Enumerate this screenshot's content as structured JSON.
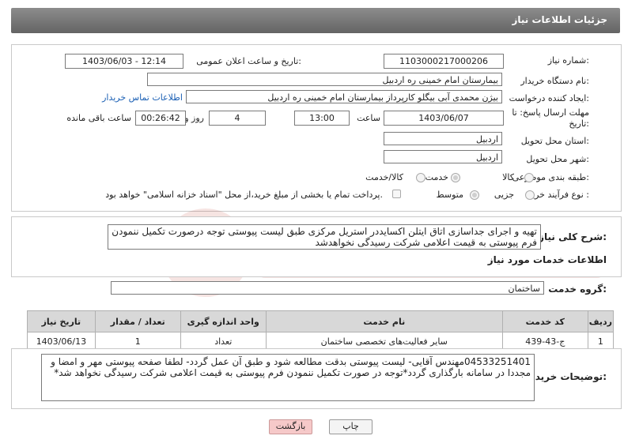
{
  "header": {
    "title": "جزئیات اطلاعات نیاز"
  },
  "form": {
    "need_number_label": "شماره نیاز:",
    "need_number": "1103000217000206",
    "announce_label": "تاریخ و ساعت اعلان عمومی:",
    "announce_value": "1403/06/03 - 12:14",
    "buyer_org_label": "نام دستگاه خریدار:",
    "buyer_org": "بیمارستان امام خمینی  ره  اردبیل",
    "creator_label": "ایجاد کننده درخواست:",
    "creator": "بیژن محمدی آبی بیگلو کارپرداز بیمارستان امام خمینی  ره  اردبیل",
    "contact_link": "اطلاعات تماس خریدار",
    "deadline_label_1": "مهلت ارسال پاسخ: تا",
    "deadline_label_2": "تاریخ:",
    "deadline_date": "1403/06/07",
    "time_label": "ساعت",
    "deadline_time": "13:00",
    "days": "4",
    "days_label": "روز و",
    "remaining_time": "00:26:42",
    "remaining_label": "ساعت باقی مانده",
    "province_label": "استان محل تحویل:",
    "province": "اردبیل",
    "city_label": "شهر محل تحویل:",
    "city": "اردبیل",
    "category_label": "طبقه بندی موضوعی:",
    "category_options": [
      "کالا",
      "خدمت",
      "کالا/خدمت"
    ],
    "category_selected": "خدمت",
    "process_label": "نوع فرآیند خرید :",
    "process_options": [
      "جزیی",
      "متوسط"
    ],
    "process_selected": "متوسط",
    "payment_note": "پرداخت تمام یا بخشی از مبلغ خرید،از محل \"اسناد خزانه اسلامی\" خواهد بود."
  },
  "summary": {
    "label": "شرح کلی نیاز:",
    "text": "تهیه و اجرای جداسازی اتاق ایتلن اکسایددر استریل مرکزی طبق لیست پیوستی توجه درصورت تکمیل ننمودن فرم پیوستی به قیمت اعلامی شرکت رسیدگی نخواهدشد"
  },
  "services": {
    "section_title": "اطلاعات خدمات مورد نیاز",
    "group_label": "گروه خدمت:",
    "group_value": "ساختمان",
    "columns": [
      "ردیف",
      "کد خدمت",
      "نام خدمت",
      "واحد اندازه گیری",
      "تعداد / مقدار",
      "تاریخ نیاز"
    ],
    "rows": [
      [
        "1",
        "ج-43-439",
        "سایر فعالیت‌های تخصصی ساختمان",
        "تعداد",
        "1",
        "1403/06/13"
      ]
    ]
  },
  "buyer_notes": {
    "label": "توضیحات خریدار:",
    "text": "04533251401مهندس آقایی- لیست پیوستی بدقت مطالعه شود و طبق آن عمل گردد- لطفا صفحه پیوستی مهر و امضا و مجددا در سامانه بارگذاری گردد*توجه در صورت تکمیل ننمودن فرم پیوستی به قیمت اعلامی شرکت رسیدگی نخواهد شد*"
  },
  "buttons": {
    "print": "چاپ",
    "back": "بازگشت"
  },
  "colors": {
    "header_bg": "#6e6e6e",
    "link": "#1a5fb4",
    "back_button": "#f6c9c9",
    "table_header": "#d8d8d8"
  }
}
